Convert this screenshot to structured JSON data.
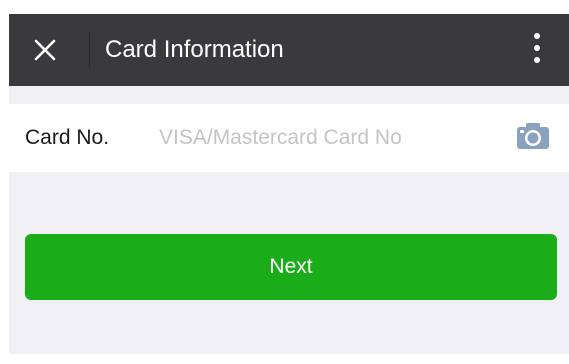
{
  "header": {
    "title": "Card Information",
    "close_icon": "close-icon",
    "more_icon": "more-vertical-icon",
    "background_color": "#3a3a3c"
  },
  "form": {
    "card_label": "Card No.",
    "card_placeholder": "VISA/Mastercard Card No",
    "card_value": "",
    "camera_icon": "camera-icon"
  },
  "actions": {
    "next_label": "Next",
    "next_color": "#1aad19"
  }
}
